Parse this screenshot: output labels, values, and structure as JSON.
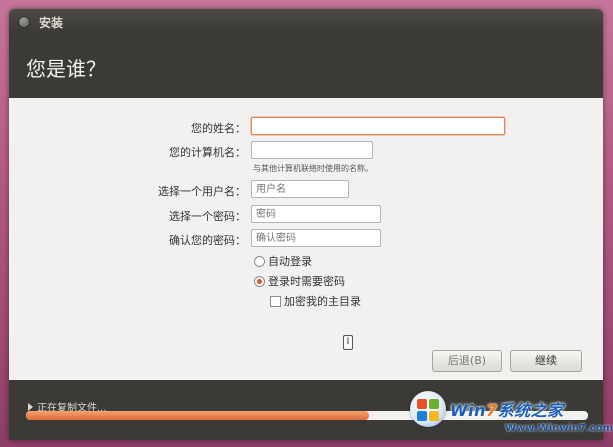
{
  "window": {
    "title": "安装"
  },
  "page": {
    "heading": "您是谁？"
  },
  "form": {
    "name_label": "您的姓名：",
    "name_value": "",
    "computer_label": "您的计算机名：",
    "computer_value": "",
    "computer_hint": "与其他计算机联络时使用的名称。",
    "username_label": "选择一个用户名：",
    "username_placeholder": "用户名",
    "password_label": "选择一个密码：",
    "password_placeholder": "密码",
    "confirm_label": "确认您的密码：",
    "confirm_placeholder": "确认密码",
    "auto_login_label": "自动登录",
    "require_password_label": "登录时需要密码",
    "encrypt_home_label": "加密我的主目录",
    "selected_login_option": "登录时需要密码",
    "encrypt_home_checked": false
  },
  "buttons": {
    "back": "后退(B)",
    "continue": "继续"
  },
  "status": {
    "text": "正在复制文件...",
    "progress_percent": 61
  },
  "watermark": {
    "brand_a": "Win",
    "brand_b": "7",
    "brand_c": "系统之家",
    "url": "Www.Winwin7.com"
  },
  "colors": {
    "accent": "#e06a3a",
    "window_dark": "#3b3a36",
    "content_bg": "#f2f1f0"
  },
  "icons": {
    "close": "close-icon",
    "expander": "triangle-right-icon",
    "cursor": "text-cursor-icon",
    "logo": "windows-logo-icon"
  }
}
